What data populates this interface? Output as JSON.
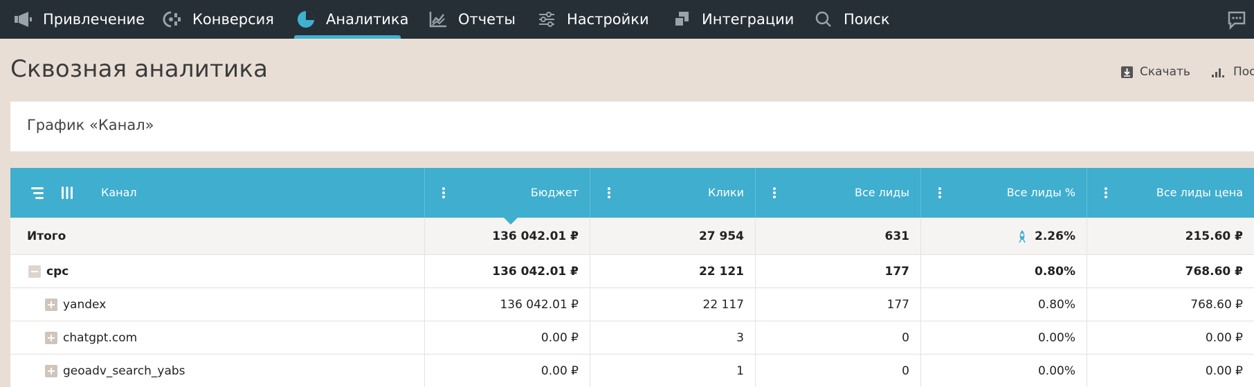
{
  "nav": {
    "items": [
      {
        "label": "Привлечение",
        "icon": "megaphone-icon"
      },
      {
        "label": "Конверсия",
        "icon": "conversion-icon"
      },
      {
        "label": "Аналитика",
        "icon": "pie-chart-icon",
        "active": true
      },
      {
        "label": "Отчеты",
        "icon": "line-chart-icon"
      },
      {
        "label": "Настройки",
        "icon": "sliders-icon"
      },
      {
        "label": "Интеграции",
        "icon": "puzzle-icon"
      },
      {
        "label": "Поиск",
        "icon": "search-icon"
      }
    ],
    "chat_icon": "chat-icon",
    "active_color": "#3fb1d1",
    "background": "#262f36"
  },
  "header": {
    "title": "Сквозная аналитика",
    "download_label": "Скачать",
    "build_label": "Пос"
  },
  "chart_card": {
    "title": "График «Канал»"
  },
  "table": {
    "header_color": "#40aece",
    "columns": [
      "Канал",
      "Бюджет",
      "Клики",
      "Все лиды",
      "Все лиды %",
      "Все лиды цена"
    ],
    "total": {
      "name": "Итого",
      "budget": "136 042.01 ₽",
      "clicks": "27 954",
      "leads": "631",
      "leads_pct": "2.26%",
      "lead_price": "215.60 ₽"
    },
    "rows": [
      {
        "name": "cpc",
        "budget": "136 042.01 ₽",
        "clicks": "22 121",
        "leads": "177",
        "leads_pct": "0.80%",
        "lead_price": "768.60 ₽",
        "expander": "minus",
        "level": 0
      },
      {
        "name": "yandex",
        "budget": "136 042.01 ₽",
        "clicks": "22 117",
        "leads": "177",
        "leads_pct": "0.80%",
        "lead_price": "768.60 ₽",
        "expander": "plus",
        "level": 1
      },
      {
        "name": "chatgpt.com",
        "budget": "0.00 ₽",
        "clicks": "3",
        "leads": "0",
        "leads_pct": "0.00%",
        "lead_price": "0.00 ₽",
        "expander": "plus",
        "level": 1
      },
      {
        "name": "geoadv_search_yabs",
        "budget": "0.00 ₽",
        "clicks": "1",
        "leads": "0",
        "leads_pct": "0.00%",
        "lead_price": "0.00 ₽",
        "expander": "plus",
        "level": 1
      }
    ]
  }
}
